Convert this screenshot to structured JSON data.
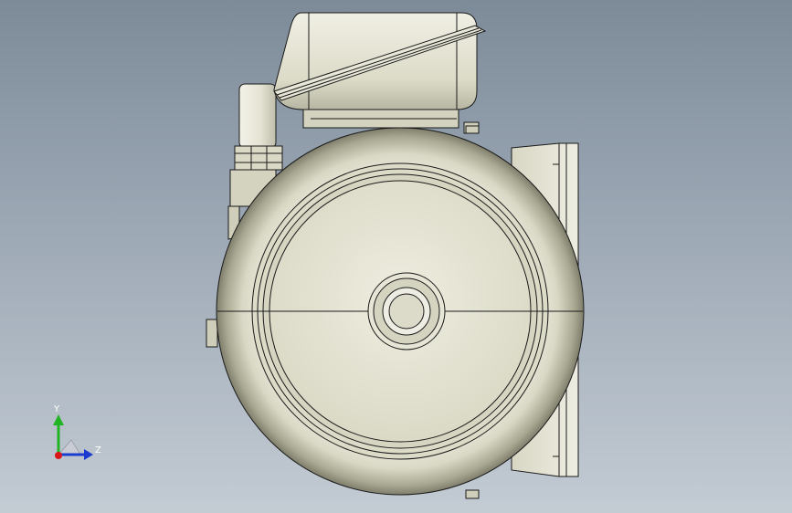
{
  "viewport": {
    "background_top": "#7d8b99",
    "background_bottom": "#c3cbd3",
    "model_fill": "#e6e5d5",
    "model_edge": "#1a1a1a"
  },
  "triad": {
    "y_label": "Y",
    "z_label": "Z",
    "y_color": "#22b422",
    "z_color": "#1c3cd0",
    "x_color": "#d81818"
  }
}
